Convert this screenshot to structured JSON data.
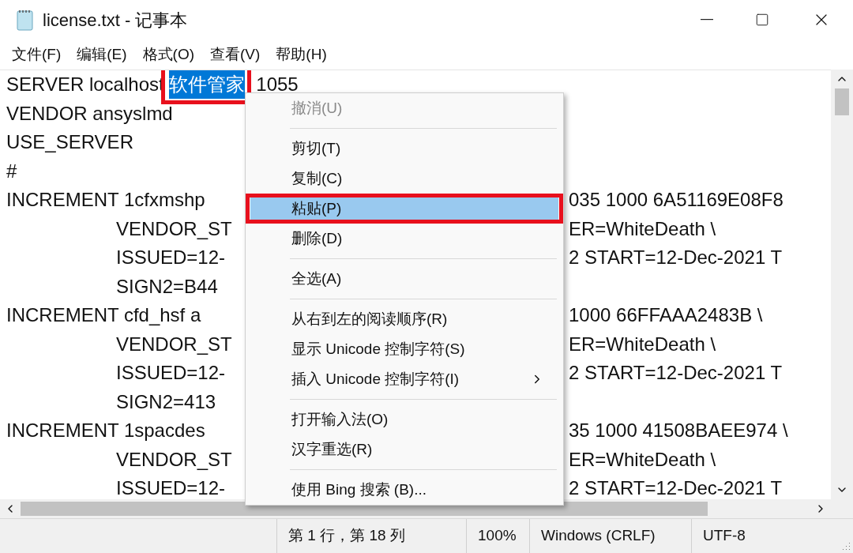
{
  "window": {
    "title": "license.txt - 记事本"
  },
  "menu_bar": [
    {
      "label": "文件(F)"
    },
    {
      "label": "编辑(E)"
    },
    {
      "label": "格式(O)"
    },
    {
      "label": "查看(V)"
    },
    {
      "label": "帮助(H)"
    }
  ],
  "editor": {
    "lines": [
      {
        "indent": false,
        "text": "SERVER localhost ",
        "selected_text": "软件管家",
        "selection_annotated": true,
        "text_after": "1055"
      },
      {
        "indent": false,
        "text": "VENDOR ansyslmd"
      },
      {
        "indent": false,
        "text": "USE_SERVER"
      },
      {
        "indent": false,
        "text": "#"
      },
      {
        "indent": false,
        "text": "INCREMENT 1cfxmshp",
        "right": "035 1000 6A51169E08F8"
      },
      {
        "indent": true,
        "text": "VENDOR_ST",
        "right": "ER=WhiteDeath \\"
      },
      {
        "indent": true,
        "text": "ISSUED=12-",
        "right": "2 START=12-Dec-2021 T"
      },
      {
        "indent": true,
        "text": "SIGN2=B44"
      },
      {
        "indent": false,
        "text": "INCREMENT cfd_hsf a",
        "right": "1000 66FFAAA2483B \\"
      },
      {
        "indent": true,
        "text": "VENDOR_ST",
        "right": "ER=WhiteDeath \\"
      },
      {
        "indent": true,
        "text": "ISSUED=12-",
        "right": "2 START=12-Dec-2021 T"
      },
      {
        "indent": true,
        "text": "SIGN2=413"
      },
      {
        "indent": false,
        "text": "INCREMENT 1spacdes",
        "right": "35 1000 41508BAEE974 \\"
      },
      {
        "indent": true,
        "text": "VENDOR_ST",
        "right": "ER=WhiteDeath \\"
      },
      {
        "indent": true,
        "text": "ISSUED=12-",
        "right": "2 START=12-Dec-2021 T"
      }
    ]
  },
  "context_menu": [
    {
      "kind": "item",
      "label": "撤消(U)",
      "disabled": true,
      "selected": false,
      "submenu": false,
      "annotated": false
    },
    {
      "kind": "separator"
    },
    {
      "kind": "item",
      "label": "剪切(T)",
      "disabled": false,
      "selected": false,
      "submenu": false,
      "annotated": false
    },
    {
      "kind": "item",
      "label": "复制(C)",
      "disabled": false,
      "selected": false,
      "submenu": false,
      "annotated": false
    },
    {
      "kind": "item",
      "label": "粘贴(P)",
      "disabled": false,
      "selected": true,
      "submenu": false,
      "annotated": true
    },
    {
      "kind": "item",
      "label": "删除(D)",
      "disabled": false,
      "selected": false,
      "submenu": false,
      "annotated": false
    },
    {
      "kind": "separator"
    },
    {
      "kind": "item",
      "label": "全选(A)",
      "disabled": false,
      "selected": false,
      "submenu": false,
      "annotated": false
    },
    {
      "kind": "separator"
    },
    {
      "kind": "item",
      "label": "从右到左的阅读顺序(R)",
      "disabled": false,
      "selected": false,
      "submenu": false,
      "annotated": false
    },
    {
      "kind": "item",
      "label": "显示 Unicode 控制字符(S)",
      "disabled": false,
      "selected": false,
      "submenu": false,
      "annotated": false
    },
    {
      "kind": "item",
      "label": "插入 Unicode 控制字符(I)",
      "disabled": false,
      "selected": false,
      "submenu": true,
      "annotated": false
    },
    {
      "kind": "separator"
    },
    {
      "kind": "item",
      "label": "打开输入法(O)",
      "disabled": false,
      "selected": false,
      "submenu": false,
      "annotated": false
    },
    {
      "kind": "item",
      "label": "汉字重选(R)",
      "disabled": false,
      "selected": false,
      "submenu": false,
      "annotated": false
    },
    {
      "kind": "separator"
    },
    {
      "kind": "item",
      "label": "使用 Bing 搜索 (B)...",
      "disabled": false,
      "selected": false,
      "submenu": false,
      "annotated": false
    }
  ],
  "status_bar": [
    {
      "text": "第 1 行，第 18 列"
    },
    {
      "text": "100%"
    },
    {
      "text": "Windows (CRLF)"
    },
    {
      "text": "UTF-8"
    }
  ]
}
